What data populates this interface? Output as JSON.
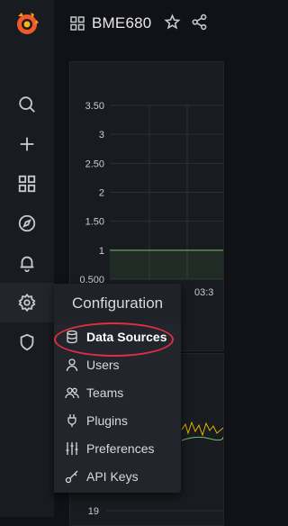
{
  "app": {
    "name": "Grafana",
    "accent": "#f05a28"
  },
  "topbar": {
    "title": "BME680",
    "star_icon": "star-icon",
    "share_icon": "share-icon"
  },
  "sidebar": {
    "items": [
      {
        "icon": "search-icon"
      },
      {
        "icon": "plus-icon"
      },
      {
        "icon": "dashboards-icon"
      },
      {
        "icon": "explore-icon"
      },
      {
        "icon": "bell-icon"
      },
      {
        "icon": "gear-icon",
        "active": true
      },
      {
        "icon": "shield-icon"
      }
    ]
  },
  "chart_data": {
    "type": "line",
    "yticks": [
      "3.50",
      "3",
      "2.50",
      "2",
      "1.50",
      "1",
      "0.500"
    ],
    "xticks": [
      "03:3"
    ],
    "series": [
      {
        "x": [
          0,
          1
        ],
        "y": [
          1,
          1
        ]
      }
    ],
    "ylim": [
      0.5,
      3.5
    ],
    "color": "#73bf69"
  },
  "panel2": {
    "yticks": [
      "19"
    ]
  },
  "flyout": {
    "header": "Configuration",
    "items": [
      {
        "label": "Data Sources",
        "icon": "database-icon",
        "highlighted": true
      },
      {
        "label": "Users",
        "icon": "user-icon"
      },
      {
        "label": "Teams",
        "icon": "users-icon"
      },
      {
        "label": "Plugins",
        "icon": "plug-icon"
      },
      {
        "label": "Preferences",
        "icon": "sliders-icon"
      },
      {
        "label": "API Keys",
        "icon": "key-icon"
      }
    ],
    "annotation_color": "#e02f44"
  }
}
